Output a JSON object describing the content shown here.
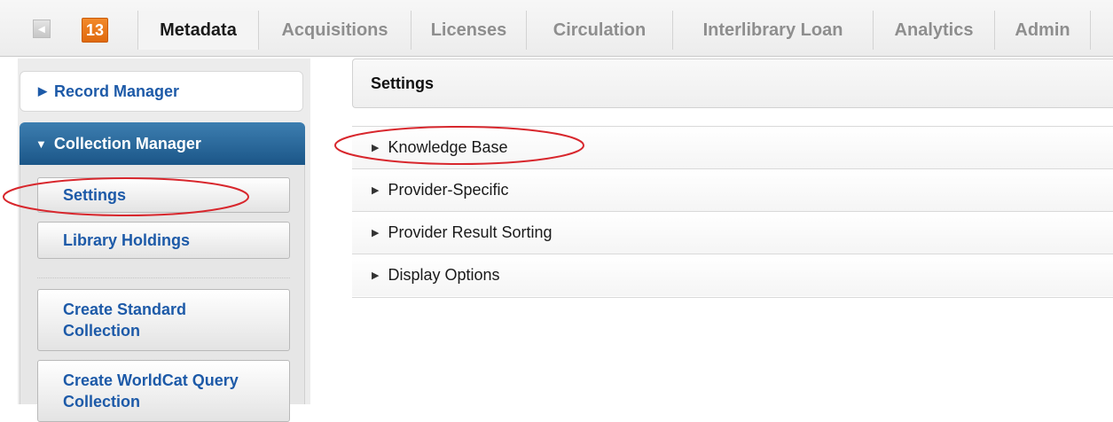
{
  "topbar": {
    "badge": "13",
    "collapse_glyph": "◂",
    "tabs": [
      {
        "label": "Metadata"
      },
      {
        "label": "Acquisitions"
      },
      {
        "label": "Licenses"
      },
      {
        "label": "Circulation"
      },
      {
        "label": "Interlibrary Loan"
      },
      {
        "label": "Analytics"
      },
      {
        "label": "Admin"
      }
    ]
  },
  "sidebar": {
    "record_manager": {
      "label": "Record Manager",
      "icon": "triangle-right-icon"
    },
    "collection_manager": {
      "label": "Collection Manager",
      "icon": "triangle-down-icon"
    },
    "items": [
      {
        "label": "Settings"
      },
      {
        "label": "Library Holdings"
      },
      {
        "label": "Create Standard Collection"
      },
      {
        "label": "Create WorldCat Query Collection"
      }
    ]
  },
  "main": {
    "title": "Settings",
    "sections": [
      {
        "label": "Knowledge Base"
      },
      {
        "label": "Provider-Specific"
      },
      {
        "label": "Provider Result Sorting"
      },
      {
        "label": "Display Options"
      }
    ]
  },
  "annotation_color": "#d8272d"
}
